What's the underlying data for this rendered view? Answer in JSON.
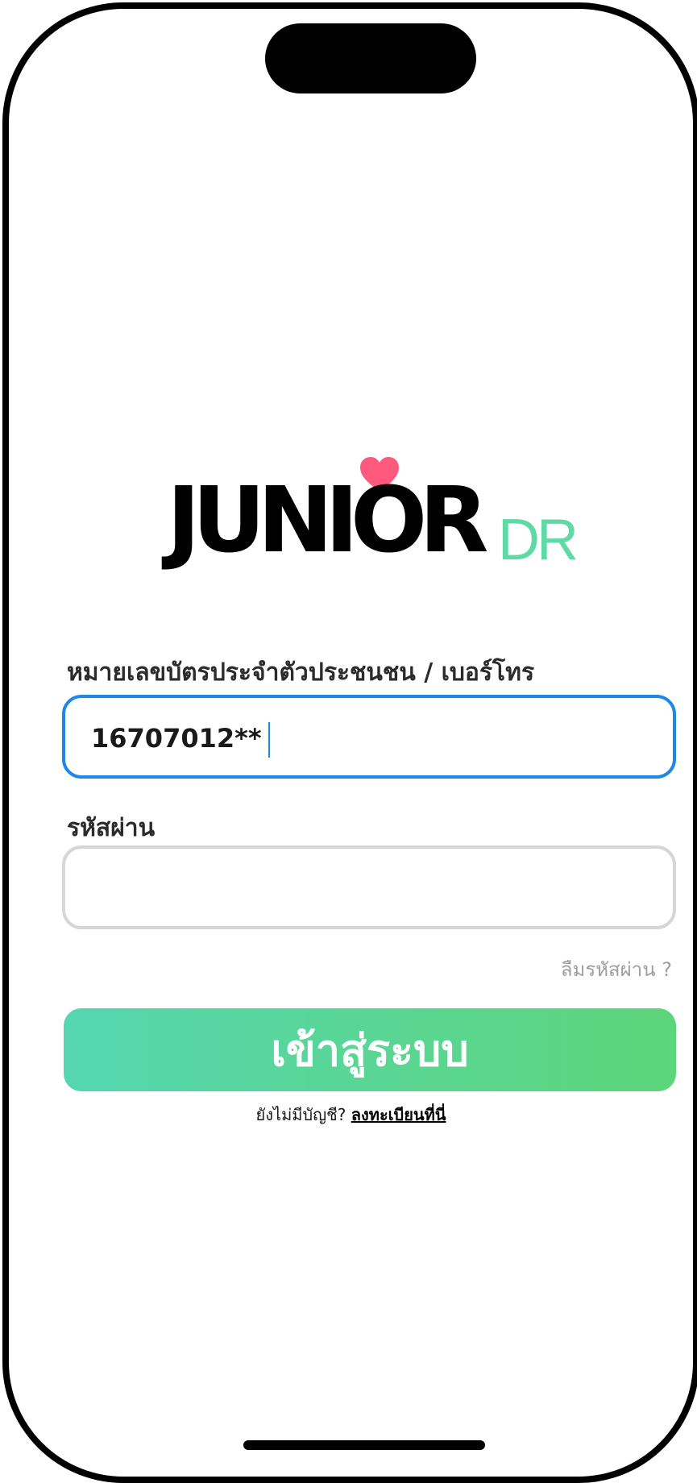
{
  "brand": {
    "logo_main": "JUNIOR",
    "logo_suffix": "DR",
    "accent_green": "#5fd9a6",
    "heart_color": "#ff5a7e"
  },
  "form": {
    "id_label": "หมายเลขบัตรประจำตัวประชนชน / เบอร์โทร",
    "id_value": "16707012**",
    "password_label": "รหัสผ่าน",
    "password_value": "",
    "forgot_password": "ลืมรหัสผ่าน ?",
    "login_button": "เข้าสู่ระบบ",
    "no_account_text": "ยังไม่มีบัญชี?",
    "register_link": "ลงทะเบียนที่นี่"
  },
  "colors": {
    "focus_border": "#1e88e5",
    "idle_border": "#d6d6d6",
    "button_gradient_start": "#55d6b0",
    "button_gradient_end": "#5dd57a"
  }
}
